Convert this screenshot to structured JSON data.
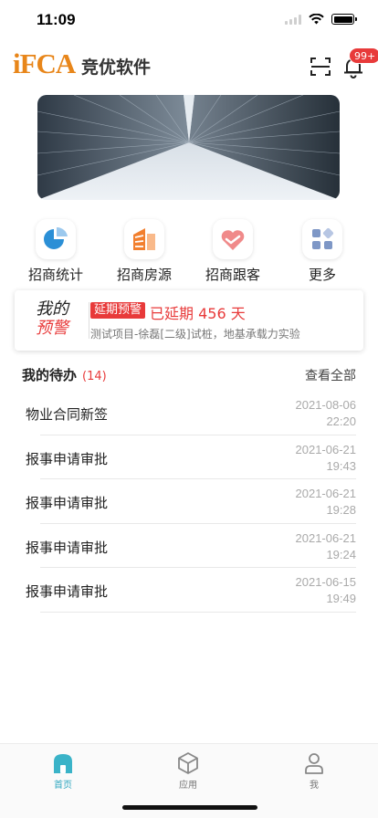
{
  "status_bar": {
    "time": "11:09"
  },
  "header": {
    "logo_text": "iFCA",
    "brand_name": "竞优软件",
    "notification_badge": "99+"
  },
  "quick_menu": [
    {
      "label": "招商统计",
      "icon": "pie-chart-icon"
    },
    {
      "label": "招商房源",
      "icon": "building-icon"
    },
    {
      "label": "招商跟客",
      "icon": "heart-handshake-icon"
    },
    {
      "label": "更多",
      "icon": "grid-icon"
    }
  ],
  "warning": {
    "title_line1": "我的",
    "title_line2": "预警",
    "tag": "延期预警",
    "status": "已延期 456 天",
    "description": "测试项目-徐磊[二级]试桩，地基承载力实验"
  },
  "todo": {
    "title": "我的待办",
    "count": "(14)",
    "view_all": "查看全部",
    "items": [
      {
        "name": "物业合同新签",
        "date": "2021-08-06",
        "time": "22:20"
      },
      {
        "name": "报事申请审批",
        "date": "2021-06-21",
        "time": "19:43"
      },
      {
        "name": "报事申请审批",
        "date": "2021-06-21",
        "time": "19:28"
      },
      {
        "name": "报事申请审批",
        "date": "2021-06-21",
        "time": "19:24"
      },
      {
        "name": "报事申请审批",
        "date": "2021-06-15",
        "time": "19:49"
      }
    ]
  },
  "tabs": [
    {
      "label": "首页",
      "icon": "home-icon",
      "active": true
    },
    {
      "label": "应用",
      "icon": "cube-icon",
      "active": false
    },
    {
      "label": "我",
      "icon": "user-icon",
      "active": false
    }
  ],
  "colors": {
    "brand_orange": "#e8861a",
    "alert_red": "#e83a3a",
    "tab_active": "#2fa7c0"
  }
}
